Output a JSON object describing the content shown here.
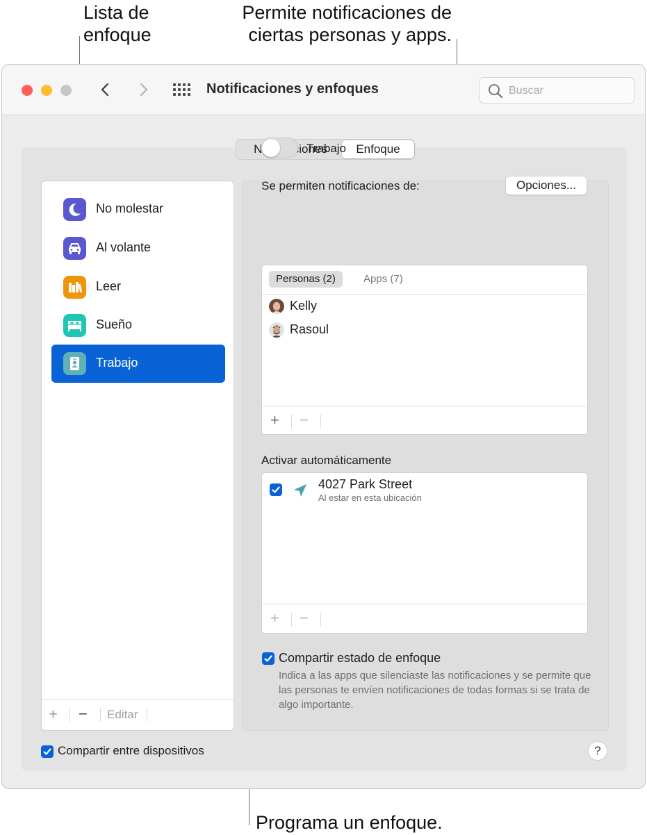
{
  "callouts": {
    "focus_list": "Lista de\nenfoque",
    "allow_notifications": "Permite notificaciones de\nciertas personas y apps.",
    "schedule": "Programa un enfoque."
  },
  "window": {
    "title": "Notificaciones y enfoques",
    "search_placeholder": "Buscar"
  },
  "tabs": [
    {
      "label": "Notificaciones",
      "active": false
    },
    {
      "label": "Enfoque",
      "active": true
    }
  ],
  "focus_list": {
    "items": [
      {
        "label": "No molestar",
        "icon": "moon-icon",
        "color": "#5b57d1"
      },
      {
        "label": "Al volante",
        "icon": "car-icon",
        "color": "#5b57d1"
      },
      {
        "label": "Leer",
        "icon": "books-icon",
        "color": "#f0940b"
      },
      {
        "label": "Sueño",
        "icon": "bed-icon",
        "color": "#20c5b3"
      },
      {
        "label": "Trabajo",
        "icon": "badge-icon",
        "color": "#5fb0b7",
        "selected": true
      }
    ],
    "footer": {
      "add": "+",
      "remove": "−",
      "edit": "Editar"
    },
    "share_across_devices": {
      "label": "Compartir entre dispositivos",
      "checked": true
    }
  },
  "detail": {
    "toggle_label": "Trabajo",
    "toggle_on": false,
    "allowed_from_label": "Se permiten notificaciones de:",
    "options_button": "Opciones...",
    "subtabs": [
      {
        "label": "Personas (2)",
        "active": true
      },
      {
        "label": "Apps (7)",
        "active": false
      }
    ],
    "people": [
      "Kelly",
      "Rasoul"
    ],
    "people_footer": {
      "add": "+",
      "remove": "−"
    },
    "auto_activate_label": "Activar automáticamente",
    "automation": {
      "title": "4027 Park Street",
      "subtitle": "Al estar en esta ubicación",
      "checked": true
    },
    "automation_footer": {
      "add": "+",
      "remove": "−"
    },
    "share_focus": {
      "label": "Compartir estado de enfoque",
      "checked": true,
      "description": "Indica a las apps que silenciaste las notificaciones y se permite que las personas te envíen notificaciones de todas formas si se trata de algo importante."
    },
    "help": "?"
  },
  "colors": {
    "accent": "#0a63d6",
    "close": "#fe5f57",
    "minimize": "#febc2e",
    "zoom": "#c7c7c7"
  }
}
